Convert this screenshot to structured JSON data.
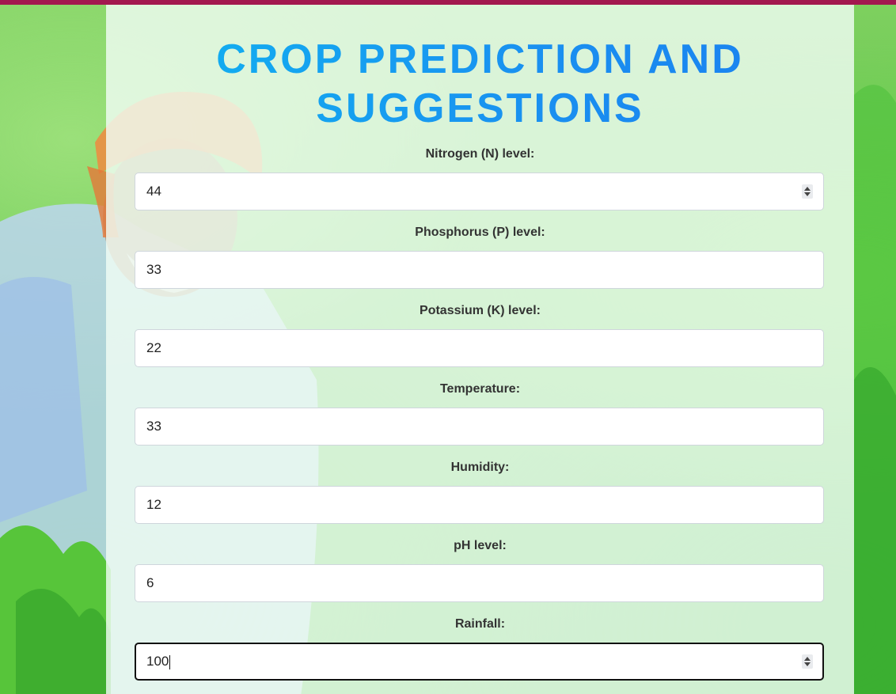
{
  "page": {
    "title": "CROP PREDICTION AND SUGGESTIONS"
  },
  "colors": {
    "top_bar": "#a3184f",
    "title_gradient_start": "#10b4f0",
    "title_gradient_end": "#1b7ff0",
    "label_text": "#333333"
  },
  "form": {
    "fields": [
      {
        "label": "Nitrogen (N) level:",
        "value": "44",
        "has_spinner": true,
        "focused": false
      },
      {
        "label": "Phosphorus (P) level:",
        "value": "33",
        "has_spinner": false,
        "focused": false
      },
      {
        "label": "Potassium (K) level:",
        "value": "22",
        "has_spinner": false,
        "focused": false
      },
      {
        "label": "Temperature:",
        "value": "33",
        "has_spinner": false,
        "focused": false
      },
      {
        "label": "Humidity:",
        "value": "12",
        "has_spinner": false,
        "focused": false
      },
      {
        "label": "pH level:",
        "value": "6",
        "has_spinner": false,
        "focused": false
      },
      {
        "label": "Rainfall:",
        "value": "100",
        "has_spinner": true,
        "focused": true
      }
    ]
  }
}
